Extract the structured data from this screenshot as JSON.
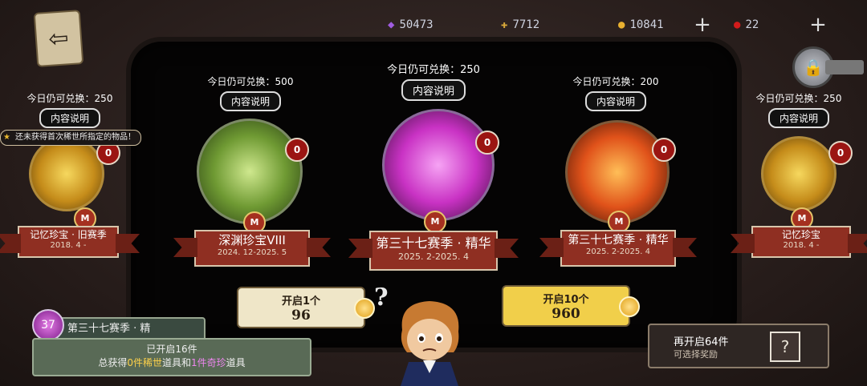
{
  "resources": {
    "crystal": {
      "icon": "crystal-icon",
      "value": "50473",
      "color": "#a05ce0"
    },
    "puzzle": {
      "icon": "puzzle-piece-icon",
      "value": "7712",
      "color": "#d8a83a"
    },
    "coin": {
      "icon": "coin-icon",
      "value": "10841",
      "color": "#e8b030"
    },
    "ruby": {
      "icon": "ruby-icon",
      "value": "22",
      "color": "#d21b1b"
    }
  },
  "tooltip": {
    "text": "还未获得首次稀世所指定的物品！"
  },
  "chests": [
    {
      "redeem": "今日仍可兑换：250",
      "info": "内容说明",
      "count": "0",
      "name": "记忆珍宝 · 旧赛季",
      "date": "2018. 4 -",
      "emblem": "M",
      "color": "#e3b52c"
    },
    {
      "redeem": "今日仍可兑换：500",
      "info": "内容说明",
      "count": "0",
      "name": "深渊珍宝VIII",
      "date": "2024. 12-2025. 5",
      "emblem": "M",
      "color": "#5f8f32"
    },
    {
      "redeem": "今日仍可兑换：250",
      "info": "内容说明",
      "count": "0",
      "name": "第三十七赛季 · 精华",
      "date": "2025. 2-2025. 4",
      "emblem": "M",
      "color": "#cf38c9"
    },
    {
      "redeem": "今日仍可兑换：200",
      "info": "内容说明",
      "count": "0",
      "name": "第三十七赛季 · 精华",
      "date": "2025. 2-2025. 4",
      "emblem": "M",
      "color": "#e0541a"
    },
    {
      "redeem": "今日仍可兑换：250",
      "info": "内容说明",
      "count": "0",
      "name": "记忆珍宝",
      "date": "2018. 4 -",
      "emblem": "M",
      "color": "#e3b52c"
    }
  ],
  "open_one": {
    "label": "开启1个",
    "cost": "96"
  },
  "open_ten": {
    "label": "开启10个",
    "cost": "960"
  },
  "season": {
    "title": "第三十七赛季 · 精",
    "opened": "已开启16件",
    "summary_a": "总获得",
    "rare_count": "0",
    "rare_label": "件稀世",
    "mid": "道具和",
    "treasure_count": "1",
    "treasure_label": "件奇珍",
    "tail": "道具"
  },
  "more": {
    "line1": "再开启64件",
    "line2": "可选择奖励",
    "qmark": "?"
  },
  "qmark": "?"
}
